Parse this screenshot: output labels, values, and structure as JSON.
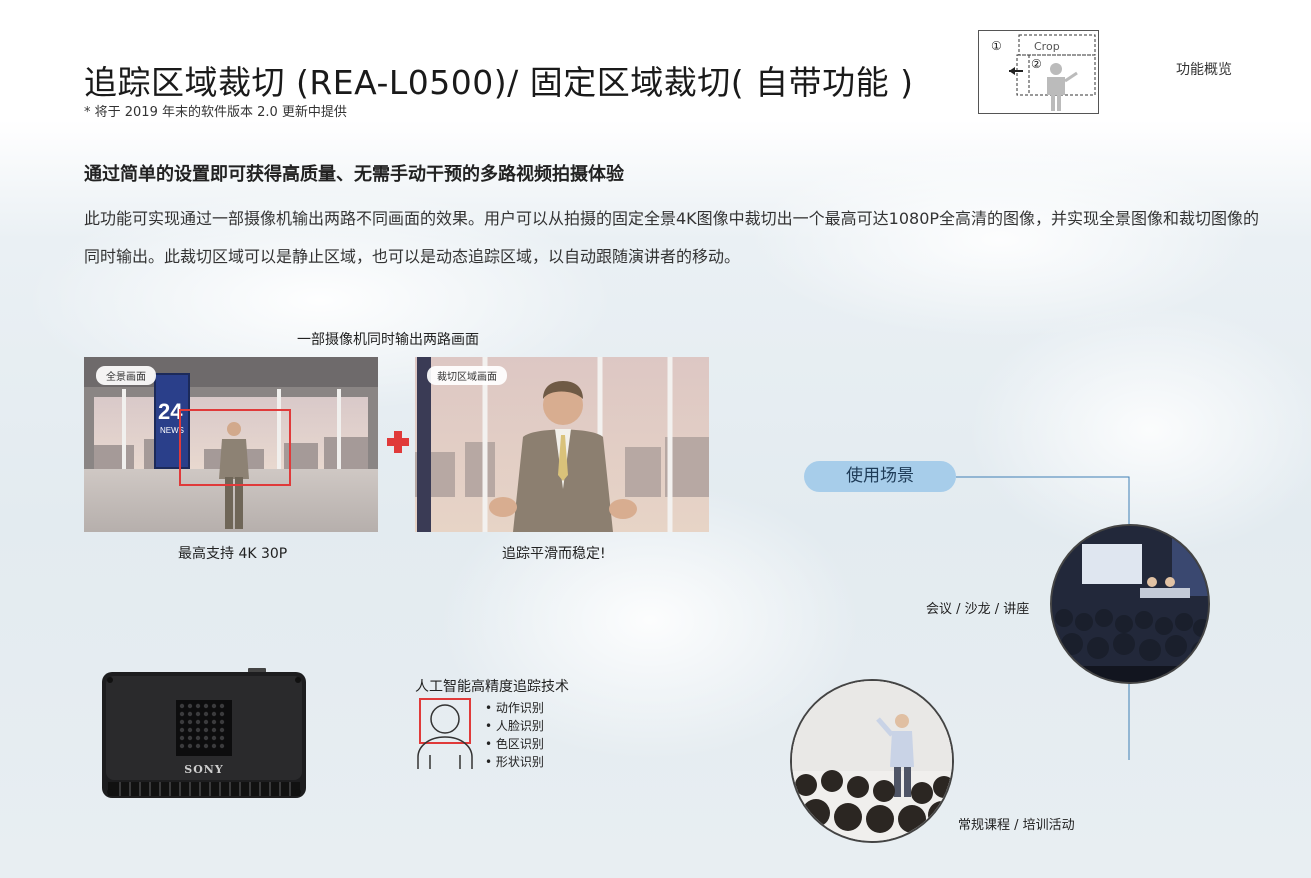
{
  "header": {
    "title": "追踪区域裁切 (REA-L0500)/ 固定区域裁切( 自带功能 )",
    "note": "* 将于 2019 年末的软件版本 2.0 更新中提供",
    "section_label": "功能概览",
    "diagram": {
      "marker1": "①",
      "marker2": "②",
      "crop_label": "Crop"
    }
  },
  "intro": {
    "subheading": "通过简单的设置即可获得高质量、无需手动干预的多路视频拍摄体验",
    "body": "此功能可实现通过一部摄像机输出两路不同画面的效果。用户可以从拍摄的固定全景4K图像中裁切出一个最高可达1080P全高清的图像，并实现全景图像和裁切图像的同时输出。此裁切区域可以是静止区域，也可以是动态追踪区域，以自动跟随演讲者的移动。"
  },
  "comparison": {
    "caption_top": "一部摄像机同时输出两路画面",
    "pano_chip": "全景画面",
    "pano_caption": "最高支持 4K 30P",
    "crop_chip": "裁切区域画面",
    "crop_caption": "追踪平滑而稳定!",
    "screen_text": "24",
    "screen_subtext": "NEWS"
  },
  "usage": {
    "label": "使用场景",
    "scenes": [
      {
        "caption": "会议 / 沙龙 / 讲座"
      },
      {
        "caption": "常规课程 / 培训活动"
      }
    ]
  },
  "device": {
    "brand": "SONY"
  },
  "ai": {
    "title": "人工智能高精度追踪技术",
    "items": [
      "动作识别",
      "人脸识别",
      "色区识别",
      "形状识别"
    ]
  },
  "colors": {
    "accent_red": "#e03a3a",
    "pill_blue": "#a7cdea",
    "line_blue": "#3f7fb5"
  }
}
